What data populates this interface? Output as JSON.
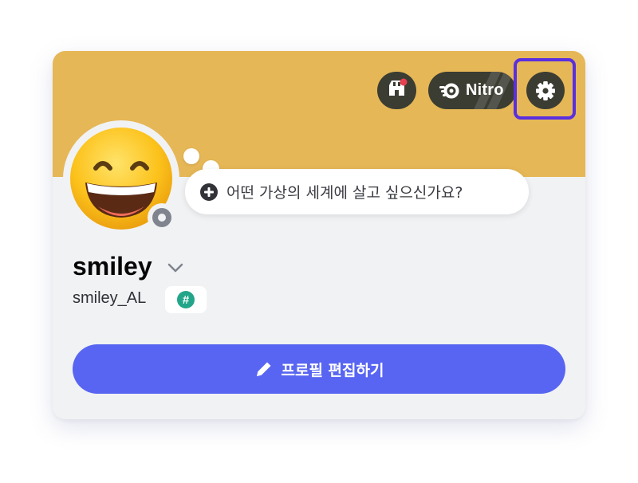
{
  "profile": {
    "display_name": "smiley",
    "username": "smiley_AL",
    "tag_badge": "#",
    "status_prompt": "어떤 가상의 세계에 살고 싶으신가요?"
  },
  "banner": {
    "color": "#e6b756",
    "nitro_label": "Nitro",
    "icons": [
      "shop-icon",
      "nitro-icon",
      "gear-icon"
    ]
  },
  "actions": {
    "edit_profile_label": "프로필 편집하기"
  },
  "colors": {
    "accent": "#5865f2",
    "highlight": "#5a2fe0",
    "status": "#80848e",
    "tag": "#23a58a"
  }
}
